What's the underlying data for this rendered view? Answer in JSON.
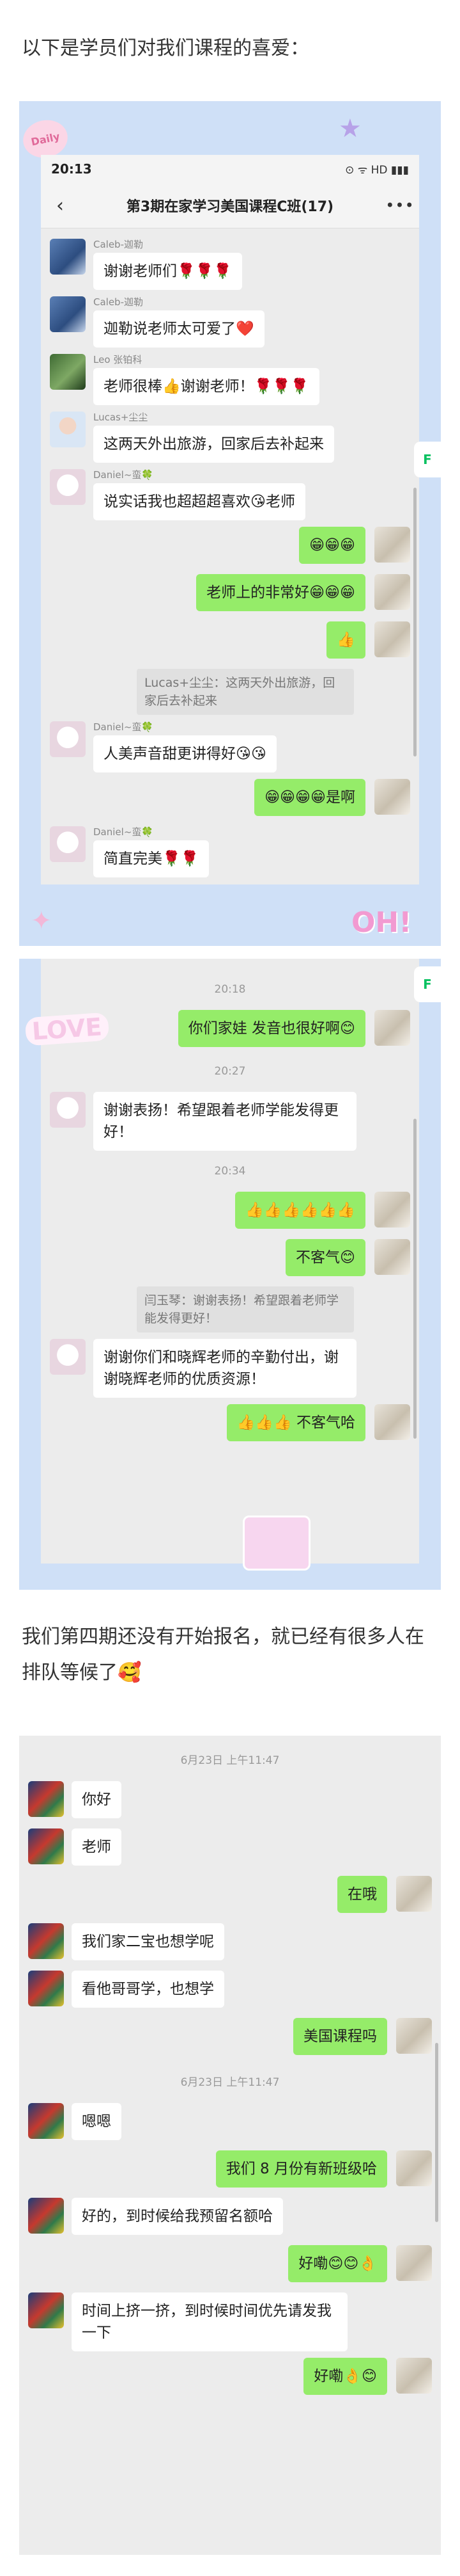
{
  "intro": "以下是学员们对我们课程的喜爱：",
  "panel1": {
    "status": {
      "time": "20:13",
      "icons": "⊙ ᯤ HD ▮▮▮"
    },
    "title": "第3期在家学习美国课程C班(17)",
    "messages": [
      {
        "side": "left",
        "name": "Caleb-迦勒",
        "text": "谢谢老师们🌹🌹🌹",
        "av": "av-a"
      },
      {
        "side": "left",
        "name": "Caleb-迦勒",
        "text": "迦勒说老师太可爱了❤️",
        "av": "av-a"
      },
      {
        "side": "left",
        "name": "Leo 张铂科",
        "text": "老师很棒👍谢谢老师！🌹🌹🌹",
        "av": "av-b"
      },
      {
        "side": "left",
        "name": "Lucas+尘尘",
        "text": "这两天外出旅游，回家后去补起来",
        "av": "av-c"
      },
      {
        "side": "left",
        "name": "Daniel~蛮🍀",
        "text": "说实话我也超超超喜欢😘老师",
        "av": "av-d"
      },
      {
        "side": "right",
        "text": "😁😁😁",
        "av": "av-me"
      },
      {
        "side": "right",
        "text": "老师上的非常好😁😁😁",
        "av": "av-me"
      },
      {
        "side": "right",
        "text": "👍",
        "av": "av-me"
      },
      {
        "side": "quote",
        "text": "Lucas+尘尘：这两天外出旅游，回家后去补起来"
      },
      {
        "side": "left",
        "name": "Daniel~蛮🍀",
        "text": "人美声音甜更讲得好😘😘",
        "av": "av-d"
      },
      {
        "side": "right",
        "text": "😁😁😁😁是啊",
        "av": "av-me"
      },
      {
        "side": "left",
        "name": "Daniel~蛮🍀",
        "text": "简直完美🌹🌹",
        "av": "av-d"
      }
    ],
    "side_tab": "F",
    "sticker_top": "Daily",
    "sticker_oh": "OH!"
  },
  "panel2": {
    "sticker_love": "LOVE",
    "items": [
      {
        "kind": "time",
        "text": "20:18"
      },
      {
        "kind": "right",
        "text": "你们家娃 发音也很好啊😊",
        "av": "av-me"
      },
      {
        "kind": "time",
        "text": "20:27"
      },
      {
        "kind": "left",
        "text": "谢谢表扬！希望跟着老师学能发得更好！",
        "av": "av-d"
      },
      {
        "kind": "time",
        "text": "20:34"
      },
      {
        "kind": "right",
        "text": "👍👍👍👍👍👍",
        "av": "av-me"
      },
      {
        "kind": "right",
        "text": "不客气😊",
        "av": "av-me"
      },
      {
        "kind": "quote",
        "text": "闫玉琴：谢谢表扬！希望跟着老师学能发得更好！"
      },
      {
        "kind": "left",
        "text": "谢谢你们和晓辉老师的辛勤付出，谢谢晓辉老师的优质资源！",
        "av": "av-d"
      },
      {
        "kind": "right",
        "text": "👍👍👍 不客气哈",
        "av": "av-me"
      }
    ],
    "side_tab": "F"
  },
  "section2": "我们第四期还没有开始报名，就已经有很多人在排队等候了🥰",
  "panel3": {
    "items": [
      {
        "kind": "time",
        "text": "6月23日 上午11:47"
      },
      {
        "kind": "left",
        "text": "你好",
        "av": "av-dad"
      },
      {
        "kind": "left",
        "text": "老师",
        "av": "av-dad"
      },
      {
        "kind": "right",
        "text": "在哦",
        "av": "av-me"
      },
      {
        "kind": "left",
        "text": "我们家二宝也想学呢",
        "av": "av-dad"
      },
      {
        "kind": "left",
        "text": "看他哥哥学，也想学",
        "av": "av-dad"
      },
      {
        "kind": "right",
        "text": "美国课程吗",
        "av": "av-me"
      },
      {
        "kind": "time",
        "text": "6月23日 上午11:47"
      },
      {
        "kind": "left",
        "text": "嗯嗯",
        "av": "av-dad"
      },
      {
        "kind": "right",
        "text": "我们 8 月份有新班级哈",
        "av": "av-me"
      },
      {
        "kind": "left",
        "text": "好的，到时候给我预留名额哈",
        "av": "av-dad"
      },
      {
        "kind": "right",
        "text": "好嘞😊😊👌",
        "av": "av-me"
      },
      {
        "kind": "left",
        "text": "时间上挤一挤，到时候时间优先请发我一下",
        "av": "av-dad"
      },
      {
        "kind": "right",
        "text": "好嘞👌😊",
        "av": "av-me"
      }
    ]
  }
}
